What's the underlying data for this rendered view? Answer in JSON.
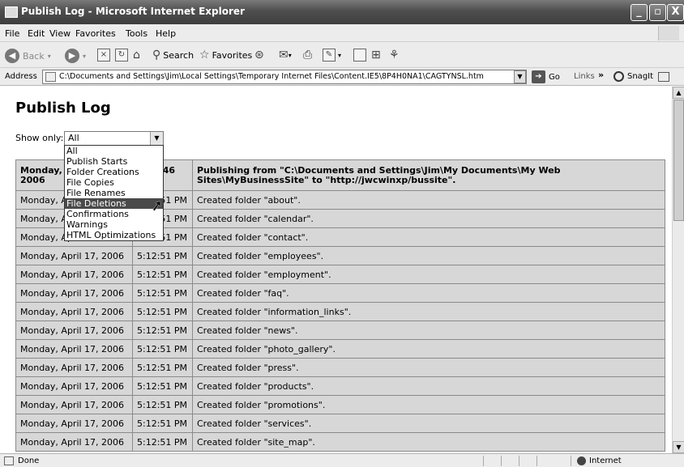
{
  "window": {
    "title": "Publish Log - Microsoft Internet Explorer",
    "controls": [
      "_",
      "▫",
      "X"
    ]
  },
  "menu": [
    "File",
    "Edit",
    "View",
    "Favorites",
    "Tools",
    "Help"
  ],
  "toolbar": {
    "back": "Back",
    "search": "Search",
    "favorites": "Favorites"
  },
  "address": {
    "label": "Address",
    "url": "C:\\Documents and Settings\\Jim\\Local Settings\\Temporary Internet Files\\Content.IE5\\8P4H0NA1\\CAGTYNSL.htm",
    "go": "Go",
    "links": "Links",
    "snagit": "SnagIt"
  },
  "page": {
    "title": "Publish Log",
    "show_only_label": "Show only:",
    "selected_filter": "All",
    "filter_options": [
      "All",
      "Publish Starts",
      "Folder Creations",
      "File Copies",
      "File Renames",
      "File Deletions",
      "Confirmations",
      "Warnings",
      "HTML Optimizations"
    ],
    "highlighted_option": "File Deletions"
  },
  "log": {
    "header": {
      "date": "Monday, April 17, 2006",
      "time": "5:12:46 PM",
      "message": "Publishing from \"C:\\Documents and Settings\\Jim\\My Documents\\My Web Sites\\MyBusinessSite\" to \"http://jwcwinxp/bussite\"."
    },
    "rows": [
      {
        "date": "Monday, April 17, 2006",
        "time": "5:12:51 PM",
        "message": "Created folder \"about\"."
      },
      {
        "date": "Monday, April 17, 2006",
        "time": "5:12:51 PM",
        "message": "Created folder \"calendar\"."
      },
      {
        "date": "Monday, April 17, 2006",
        "time": "5:12:51 PM",
        "message": "Created folder \"contact\"."
      },
      {
        "date": "Monday, April 17, 2006",
        "time": "5:12:51 PM",
        "message": "Created folder \"employees\"."
      },
      {
        "date": "Monday, April 17, 2006",
        "time": "5:12:51 PM",
        "message": "Created folder \"employment\"."
      },
      {
        "date": "Monday, April 17, 2006",
        "time": "5:12:51 PM",
        "message": "Created folder \"faq\"."
      },
      {
        "date": "Monday, April 17, 2006",
        "time": "5:12:51 PM",
        "message": "Created folder \"information_links\"."
      },
      {
        "date": "Monday, April 17, 2006",
        "time": "5:12:51 PM",
        "message": "Created folder \"news\"."
      },
      {
        "date": "Monday, April 17, 2006",
        "time": "5:12:51 PM",
        "message": "Created folder \"photo_gallery\"."
      },
      {
        "date": "Monday, April 17, 2006",
        "time": "5:12:51 PM",
        "message": "Created folder \"press\"."
      },
      {
        "date": "Monday, April 17, 2006",
        "time": "5:12:51 PM",
        "message": "Created folder \"products\"."
      },
      {
        "date": "Monday, April 17, 2006",
        "time": "5:12:51 PM",
        "message": "Created folder \"promotions\"."
      },
      {
        "date": "Monday, April 17, 2006",
        "time": "5:12:51 PM",
        "message": "Created folder \"services\"."
      },
      {
        "date": "Monday, April 17, 2006",
        "time": "5:12:51 PM",
        "message": "Created folder \"site_map\"."
      }
    ]
  },
  "status": {
    "text": "Done",
    "zone": "Internet"
  }
}
